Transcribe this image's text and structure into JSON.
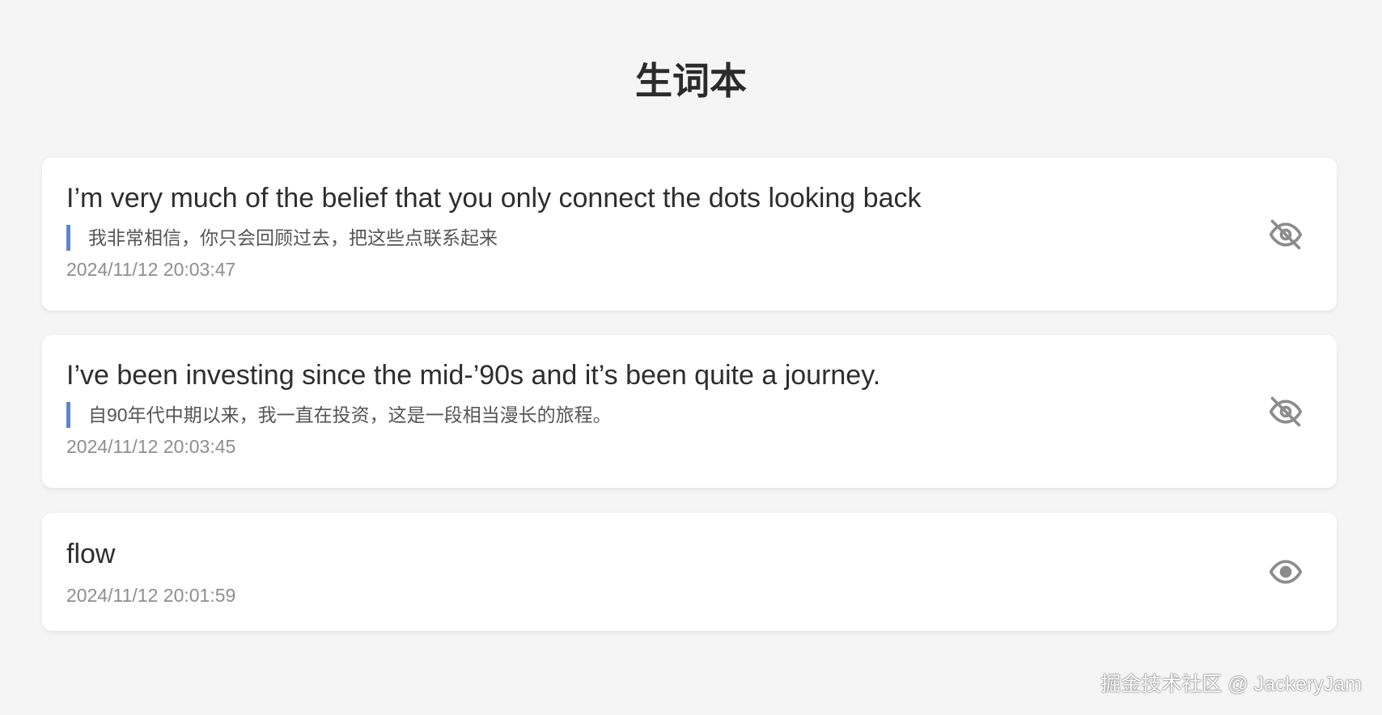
{
  "header": {
    "title": "生词本"
  },
  "entries": [
    {
      "text": "I’m very much of the belief that you only connect the dots looking back",
      "translation": "我非常相信，你只会回顾过去，把这些点联系起来",
      "timestamp": "2024/11/12 20:03:47",
      "toggle_icon": "eye-off-icon"
    },
    {
      "text": "I’ve been investing since the mid-’90s and it’s been quite a journey.",
      "translation": "自90年代中期以来，我一直在投资，这是一段相当漫长的旅程。",
      "timestamp": "2024/11/12 20:03:45",
      "toggle_icon": "eye-off-icon"
    },
    {
      "text": "flow",
      "timestamp": "2024/11/12 20:01:59",
      "toggle_icon": "eye-icon"
    }
  ],
  "watermark": "掘金技术社区 @ JackeryJam",
  "colors": {
    "background": "#f5f5f5",
    "card": "#ffffff",
    "accent_bar": "#5b87cf",
    "icon": "#8c8c8c",
    "timestamp": "#8e8e8e"
  }
}
